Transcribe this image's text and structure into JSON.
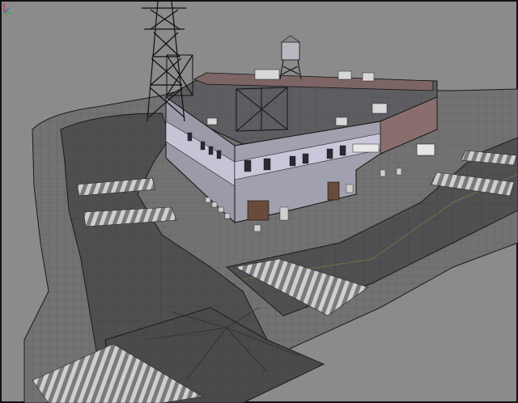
{
  "scene": {
    "kind": "3d-viewport-wireframe-on-shaded",
    "objects": [
      {
        "name": "road-network",
        "icon": "road-icon"
      },
      {
        "name": "corner-building",
        "icon": "building-icon"
      },
      {
        "name": "water-tower",
        "icon": "water-tower-icon"
      },
      {
        "name": "power-pylon",
        "icon": "pylon-icon"
      },
      {
        "name": "crosswalks",
        "icon": "crosswalk-icon"
      }
    ],
    "colors": {
      "background": "#8b8b8b",
      "sidewalk": "#6f6f6f",
      "road": "#4d4d4f",
      "building_wall": "#a8a8b4",
      "building_band": "#c8c8d8",
      "roof": "#5e5e62",
      "wire": "#1a1a1a",
      "crosswalk": "#c9c9c9"
    },
    "axis_gizmo": "axis-gizmo-icon"
  }
}
